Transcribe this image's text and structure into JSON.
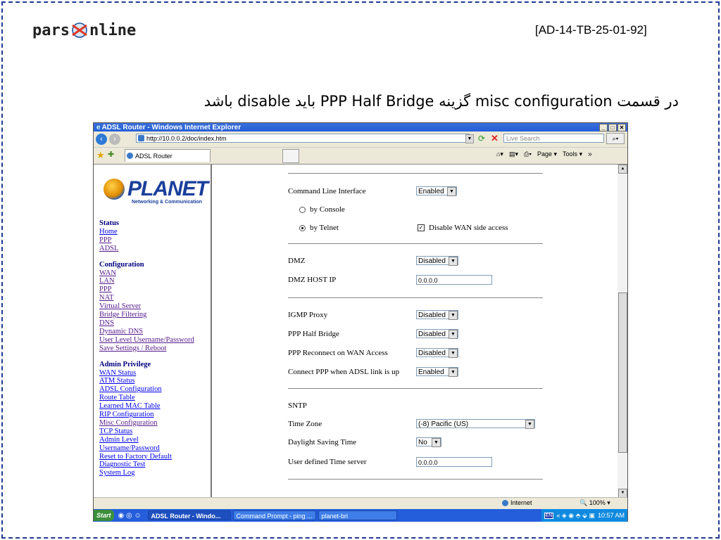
{
  "slide": {
    "logo_text_left": "pars",
    "logo_text_right": "nline",
    "reference_code": "[AD-14-TB-25-01-92]",
    "instruction": "در قسمت misc configuration گزینه PPP Half Bridge باید disable باشد"
  },
  "browser": {
    "title": "ADSL Router - Windows Internet Explorer",
    "url": "http://10.0.0.2/doc/index.htm",
    "search_placeholder": "Live Search",
    "tab_label": "ADSL Router",
    "page_menu": "Page",
    "tools_menu": "Tools"
  },
  "sidebar": {
    "brand": "PLANET",
    "brand_sub": "Networking & Communication",
    "sections": [
      {
        "title": "Status",
        "links": [
          "Home",
          "PPP",
          "ADSL"
        ]
      },
      {
        "title": "Configuration",
        "links": [
          "WAN",
          "LAN",
          "PPP",
          "NAT",
          "Virtual Server",
          "Bridge Filtering",
          "DNS",
          "Dynamic DNS",
          "User Level Username/Password",
          "Save Settings / Reboot"
        ]
      },
      {
        "title": "Admin Privilege",
        "links": [
          "WAN Status",
          "ATM Status",
          "ADSL Configuration",
          "Route Table",
          "Learned MAC Table",
          "RIP Configuration",
          "Misc Configuration",
          "TCP Status",
          "Admin Level",
          "Username/Password",
          "Reset to Factory Default",
          "Diagnostic Test",
          "System Log"
        ]
      }
    ]
  },
  "form": {
    "cli_label": "Command Line Interface",
    "cli_value": "Enabled",
    "by_console": "by Console",
    "by_telnet": "by Telnet",
    "disable_wan_label": "Disable WAN side access",
    "dmz_label": "DMZ",
    "dmz_value": "Disabled",
    "dmz_host_label": "DMZ HOST IP",
    "dmz_host_value": "0.0.0.0",
    "igmp_label": "IGMP Proxy",
    "igmp_value": "Disabled",
    "ppp_half_label": "PPP Half Bridge",
    "ppp_half_value": "Disabled",
    "ppp_reconnect_label": "PPP Reconnect on WAN Access",
    "ppp_reconnect_value": "Disabled",
    "connect_ppp_label": "Connect PPP when ADSL link is up",
    "connect_ppp_value": "Enabled",
    "sntp_label": "SNTP",
    "timezone_label": "Time Zone",
    "timezone_value": "(-8) Pacific (US)",
    "dst_label": "Daylight Saving Time",
    "dst_value": "No",
    "time_server_label": "User defined Time server",
    "time_server_value": "0.0.0.0"
  },
  "statusbar": {
    "zone": "Internet",
    "zoom": "100%"
  },
  "taskbar": {
    "start": "Start",
    "items": [
      "ADSL Router - Windo...",
      "Command Prompt - ping ...",
      "planet-bri"
    ],
    "lang": "EN",
    "clock": "10:57 AM"
  }
}
